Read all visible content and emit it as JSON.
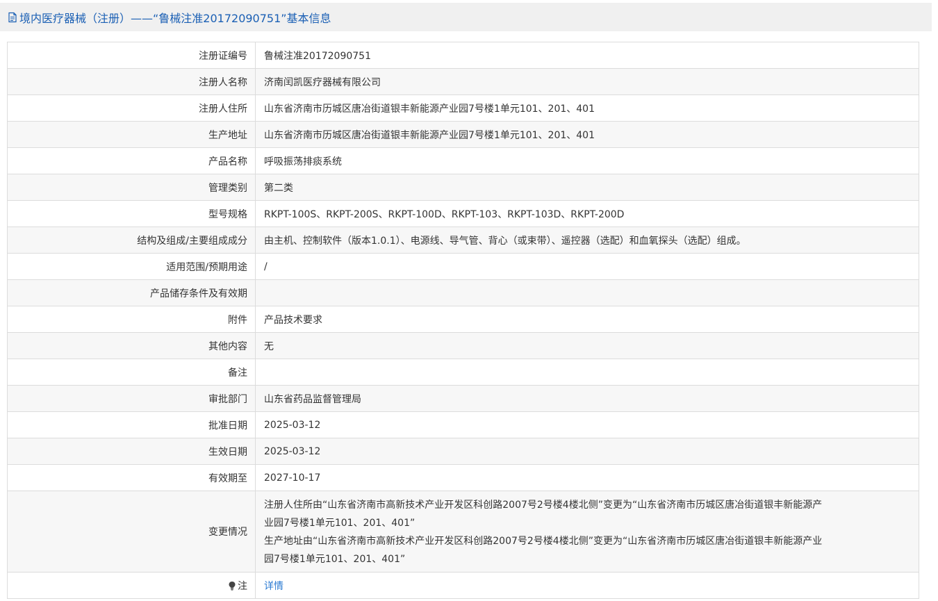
{
  "header": {
    "title": "境内医疗器械（注册）——“鲁械注准20172090751”基本信息",
    "icon": "document-icon",
    "color": "#1a5fb4"
  },
  "rows": [
    {
      "label": "注册证编号",
      "value": "鲁械注准20172090751"
    },
    {
      "label": "注册人名称",
      "value": "济南闰凯医疗器械有限公司"
    },
    {
      "label": "注册人住所",
      "value": "山东省济南市历城区唐冶街道银丰新能源产业园7号楼1单元101、201、401"
    },
    {
      "label": "生产地址",
      "value": "山东省济南市历城区唐冶街道银丰新能源产业园7号楼1单元101、201、401"
    },
    {
      "label": "产品名称",
      "value": "呼吸振荡排痰系统"
    },
    {
      "label": "管理类别",
      "value": "第二类"
    },
    {
      "label": "型号规格",
      "value": "RKPT-100S、RKPT-200S、RKPT-100D、RKPT-103、RKPT-103D、RKPT-200D"
    },
    {
      "label": "结构及组成/主要组成成分",
      "value": "由主机、控制软件（版本1.0.1）、电源线、导气管、背心（或束带）、遥控器（选配）和血氧探头（选配）组成。"
    },
    {
      "label": "适用范围/预期用途",
      "value": "/"
    },
    {
      "label": "产品储存条件及有效期",
      "value": ""
    },
    {
      "label": "附件",
      "value": "产品技术要求"
    },
    {
      "label": "其他内容",
      "value": "无"
    },
    {
      "label": "备注",
      "value": ""
    },
    {
      "label": "审批部门",
      "value": "山东省药品监督管理局"
    },
    {
      "label": "批准日期",
      "value": "2025-03-12"
    },
    {
      "label": "生效日期",
      "value": "2025-03-12"
    },
    {
      "label": "有效期至",
      "value": "2027-10-17"
    }
  ],
  "change": {
    "label": "变更情况",
    "lines": [
      "注册人住所由“山东省济南市高新技术产业开发区科创路2007号2号楼4楼北侧”变更为“山东省济南市历城区唐冶街道银丰新能源产",
      "业园7号楼1单元101、201、401”",
      "生产地址由“山东省济南市高新技术产业开发区科创路2007号2号楼4楼北侧”变更为“山东省济南市历城区唐冶街道银丰新能源产业",
      "园7号楼1单元101、201、401”"
    ]
  },
  "note": {
    "label": "注",
    "icon": "lightbulb-icon",
    "link": "详情",
    "link_color": "#2a7ad2"
  }
}
